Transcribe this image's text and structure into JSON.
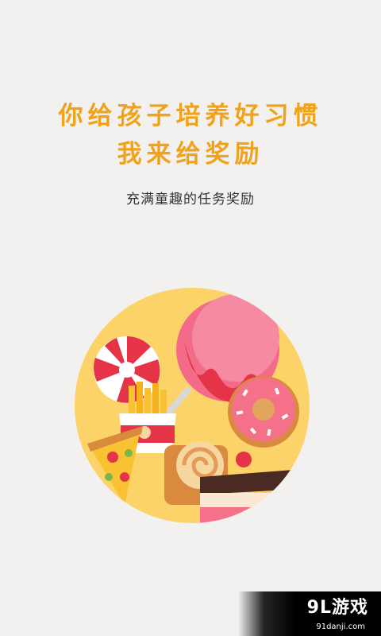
{
  "headline": {
    "line1": "你给孩子培养好习惯",
    "line2": "我来给奖励"
  },
  "subtitle": "充满童趣的任务奖励",
  "illustration": {
    "circle_color": "#fcd368",
    "items": [
      "candy-swirl",
      "lollipop",
      "donut",
      "fries",
      "pizza-slice",
      "swiss-roll",
      "cake"
    ]
  },
  "watermark": {
    "brand": "9L游戏",
    "site": "91danji.com"
  }
}
